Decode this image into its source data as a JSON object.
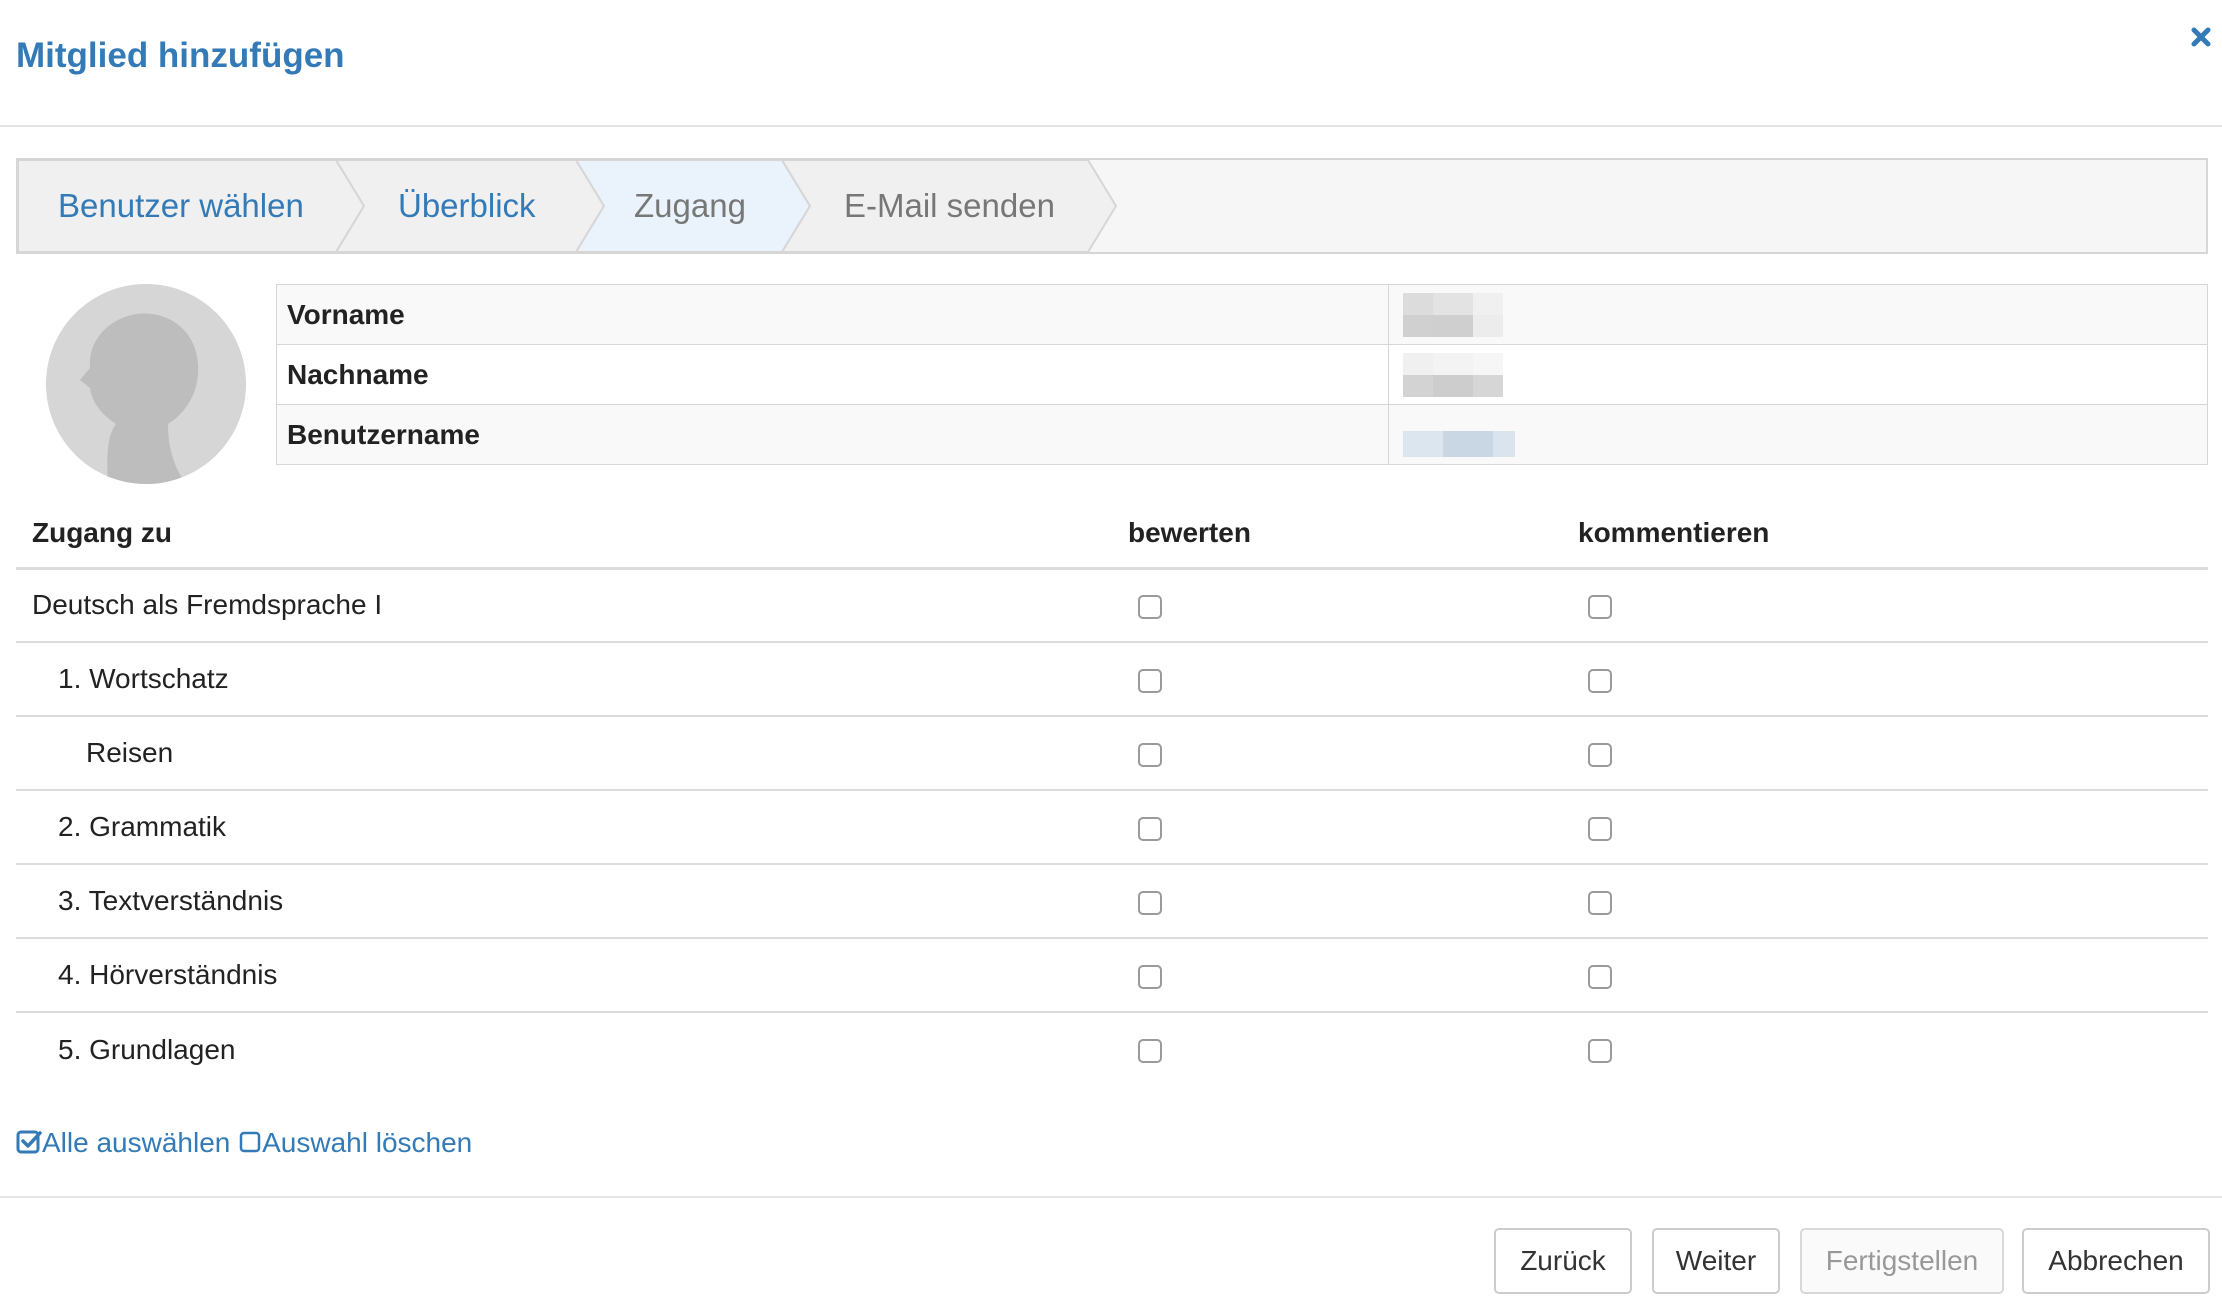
{
  "dialog": {
    "title": "Mitglied hinzufügen"
  },
  "wizard": {
    "steps": [
      {
        "label": "Benutzer wählen",
        "state": "link"
      },
      {
        "label": "Überblick",
        "state": "link"
      },
      {
        "label": "Zugang",
        "state": "active"
      },
      {
        "label": "E-Mail senden",
        "state": "upcoming"
      }
    ]
  },
  "user_info": [
    {
      "label": "Vorname"
    },
    {
      "label": "Nachname"
    },
    {
      "label": "Benutzername"
    }
  ],
  "access_table": {
    "headers": [
      "Zugang zu",
      "bewerten",
      "kommentieren"
    ],
    "rows": [
      {
        "label": "Deutsch als Fremdsprache I",
        "level": 0,
        "bewerten": false,
        "kommentieren": false
      },
      {
        "label": "1. Wortschatz",
        "level": 1,
        "bewerten": false,
        "kommentieren": false
      },
      {
        "label": "Reisen",
        "level": 2,
        "bewerten": false,
        "kommentieren": false
      },
      {
        "label": "2. Grammatik",
        "level": 1,
        "bewerten": false,
        "kommentieren": false
      },
      {
        "label": "3. Textverständnis",
        "level": 1,
        "bewerten": false,
        "kommentieren": false
      },
      {
        "label": "4. Hörverständnis",
        "level": 1,
        "bewerten": false,
        "kommentieren": false
      },
      {
        "label": "5. Grundlagen",
        "level": 1,
        "bewerten": false,
        "kommentieren": false
      }
    ]
  },
  "selectors": {
    "select_all": "Alle auswählen",
    "deselect_all": "Auswahl löschen"
  },
  "buttons": {
    "back": "Zurück",
    "next": "Weiter",
    "finish": "Fertigstellen",
    "cancel": "Abbrechen"
  },
  "colors": {
    "accent": "#337ab7",
    "active_step_bg": "#eaf3fc",
    "step_bg": "#f0f0f0"
  },
  "icons": {
    "close": "close-icon",
    "select_all": "checkbox-checked-icon",
    "deselect_all": "checkbox-empty-icon"
  }
}
